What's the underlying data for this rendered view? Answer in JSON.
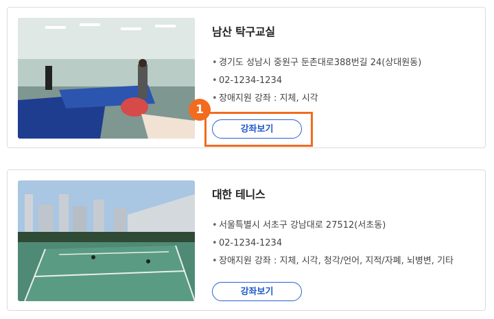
{
  "listings": [
    {
      "name": "남산 탁구교실",
      "address": "경기도 성남시 중원구 둔촌대로388번길 24(상대원동)",
      "phone": "02-1234-1234",
      "classes": "장애지원 강좌 : 지체, 시각",
      "button": "강좌보기",
      "image": "table-tennis-photo"
    },
    {
      "name": "대한 테니스",
      "address": "서울특별시 서초구 강남대로 27512(서초동)",
      "phone": "02-1234-1234",
      "classes": "장애지원 강좌 : 지체, 시각, 청각/언어, 지적/자폐, 뇌병변, 기타",
      "button": "강좌보기",
      "image": "tennis-court-photo"
    }
  ],
  "callout": {
    "number": "1",
    "color": "#f26b1f"
  },
  "colors": {
    "accent": "#1f57c9",
    "highlight": "#f26b1f"
  }
}
